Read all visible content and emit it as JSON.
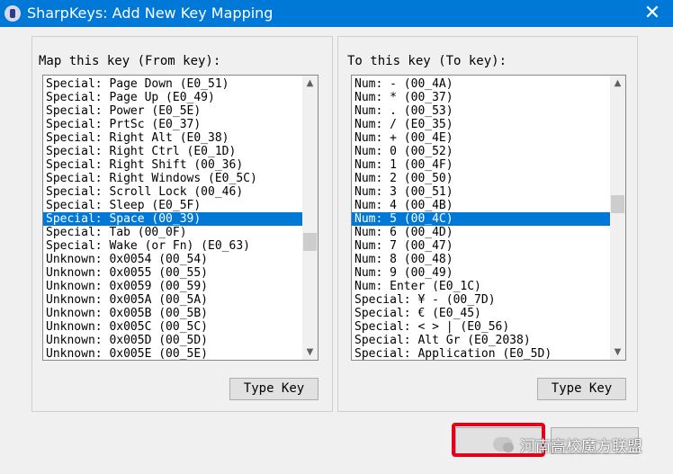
{
  "window": {
    "title": "SharpKeys: Add New Key Mapping",
    "close_glyph": "✕"
  },
  "from_group": {
    "label": "Map this key (From key):",
    "selected_index": 10,
    "items": [
      "Special: Page Down (E0_51)",
      "Special: Page Up (E0_49)",
      "Special: Power (E0_5E)",
      "Special: PrtSc (E0_37)",
      "Special: Right Alt (E0_38)",
      "Special: Right Ctrl (E0_1D)",
      "Special: Right Shift (00_36)",
      "Special: Right Windows (E0_5C)",
      "Special: Scroll Lock (00_46)",
      "Special: Sleep (E0_5F)",
      "Special: Space (00_39)",
      "Special: Tab (00_0F)",
      "Special: Wake (or Fn) (E0_63)",
      "Unknown: 0x0054 (00_54)",
      "Unknown: 0x0055 (00_55)",
      "Unknown: 0x0059 (00_59)",
      "Unknown: 0x005A (00_5A)",
      "Unknown: 0x005B (00_5B)",
      "Unknown: 0x005C (00_5C)",
      "Unknown: 0x005D (00_5D)",
      "Unknown: 0x005E (00_5E)"
    ],
    "type_key_label": "Type Key"
  },
  "to_group": {
    "label": "To this key (To key):",
    "selected_index": 10,
    "items": [
      "Num: - (00_4A)",
      "Num: * (00_37)",
      "Num: . (00_53)",
      "Num: / (E0_35)",
      "Num: + (00_4E)",
      "Num: 0 (00_52)",
      "Num: 1 (00_4F)",
      "Num: 2 (00_50)",
      "Num: 3 (00_51)",
      "Num: 4 (00_4B)",
      "Num: 5 (00_4C)",
      "Num: 6 (00_4D)",
      "Num: 7 (00_47)",
      "Num: 8 (00_48)",
      "Num: 9 (00_49)",
      "Num: Enter (E0_1C)",
      "Special: ¥ - (00_7D)",
      "Special: € (E0_45)",
      "Special: < > | (E0_56)",
      "Special: Alt Gr (E0_2038)",
      "Special: Application (E0_5D)"
    ],
    "type_key_label": "Type Key"
  },
  "watermark": {
    "text": "河南高校魔方联盟"
  },
  "colors": {
    "titlebar": "#0078d7",
    "selection": "#0078d7",
    "annotation": "#e3001b"
  }
}
